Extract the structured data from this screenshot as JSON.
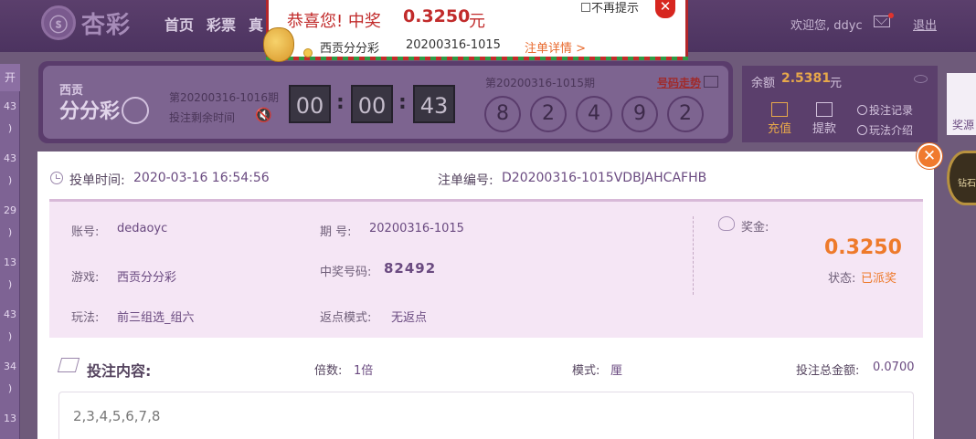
{
  "header": {
    "logo_mark": "ⓢ",
    "logo_text": "杏彩",
    "nav": [
      "首页",
      "彩票",
      "真"
    ],
    "welcome": "欢迎您, ddyc",
    "logout": "退出"
  },
  "left_strip": {
    "tab": "开",
    "numbers": [
      "43",
      ")",
      "43",
      ")",
      "29",
      ")",
      "13",
      ")",
      "43",
      ")",
      "34",
      ")",
      "13"
    ]
  },
  "draw_panel": {
    "badge_top": "西贡",
    "badge_main": "分分彩",
    "next_issue": "第20200316-1016期",
    "remain_label": "投注剩余时间",
    "countdown": [
      "00",
      "00",
      "43"
    ],
    "last_issue": "第20200316-1015期",
    "trend_link": "号码走势",
    "balls": [
      "8",
      "2",
      "4",
      "9",
      "2"
    ]
  },
  "account": {
    "balance_label": "余额",
    "balance": "2.5381",
    "unit": "元",
    "deposit": "充值",
    "withdraw": "提款",
    "bet_record": "投注记录",
    "rules": "玩法介绍",
    "deposit_color": "#e7a84a"
  },
  "promo": {
    "text": "奖源",
    "medal_text": "钻石"
  },
  "notice": {
    "title": "恭喜您! 中奖",
    "amount": "0.3250",
    "unit": "元",
    "dont_show": "不再提示",
    "close": "✕",
    "game": "西贡分分彩",
    "issue": "20200316-1015",
    "detail_link": "注单详情 >"
  },
  "detail": {
    "close": "✕",
    "bet_time_label": "投单时间:",
    "bet_time": "2020-03-16 16:54:56",
    "order_label": "注单编号:",
    "order_no": "D20200316-1015VDBJAHCAFHB",
    "account_label": "账号:",
    "account": "dedaoyc",
    "issue_label": "期 号:",
    "issue": "20200316-1015",
    "game_label": "游戏:",
    "game": "西贡分分彩",
    "win_no_label": "中奖号码:",
    "win_no": "82492",
    "play_label": "玩法:",
    "play": "前三组选_组六",
    "rebate_label": "返点模式:",
    "rebate": "无返点",
    "prize_label": "奖金:",
    "prize": "0.3250",
    "status_label": "状态:",
    "status": "已派奖",
    "content_title": "投注内容:",
    "multiple_label": "倍数:",
    "multiple": "1倍",
    "mode_label": "模式:",
    "mode": "厘",
    "total_label": "投注总金额:",
    "total": "0.0700",
    "content": "2,3,4,5,6,7,8"
  },
  "colors": {
    "accent": "#6a4a80",
    "orange": "#ee7a2b",
    "red": "#c12b2b"
  }
}
